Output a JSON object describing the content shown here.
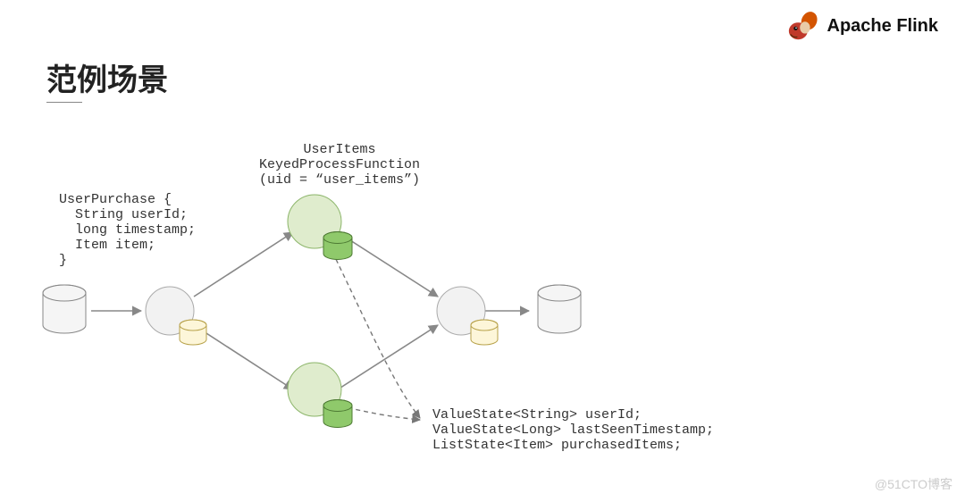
{
  "brand": {
    "name": "Apache Flink"
  },
  "title": "范例场景",
  "source_code": "UserPurchase {\n  String userId;\n  long timestamp;\n  Item item;\n}",
  "operator_code": "UserItems\nKeyedProcessFunction\n(uid = “user_items”)",
  "state_code": "ValueState<String> userId;\nValueState<Long> lastSeenTimestamp;\nListState<Item> purchasedItems;",
  "watermark": "@51CTO博客"
}
